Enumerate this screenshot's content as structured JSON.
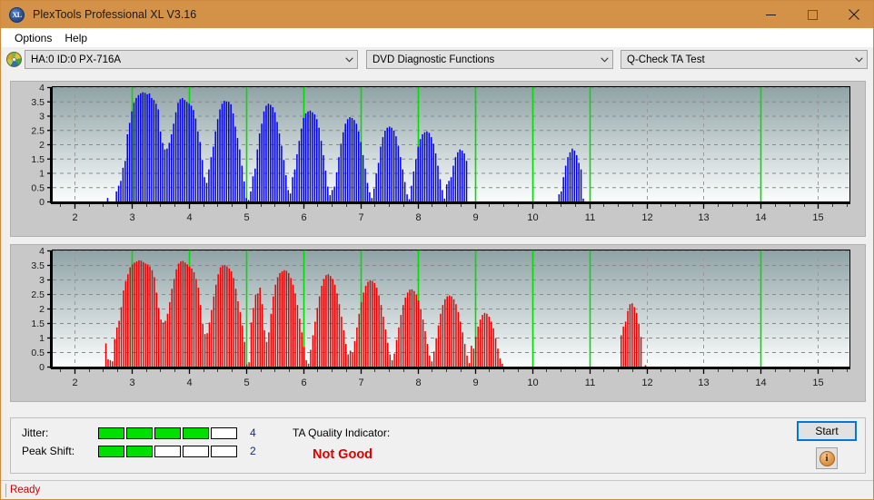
{
  "window": {
    "title": "PlexTools Professional XL V3.16",
    "icon": "xl-app-icon",
    "icon_text": "XL",
    "minimize_label": "Minimize",
    "maximize_label": "Maximize",
    "close_label": "Close"
  },
  "menu": {
    "items": [
      {
        "label": "Options"
      },
      {
        "label": "Help"
      }
    ]
  },
  "toolbar": {
    "drive": {
      "value": "HA:0 ID:0  PX-716A",
      "icon": "optical-disc-icon"
    },
    "function": {
      "value": "DVD Diagnostic Functions"
    },
    "test": {
      "value": "Q-Check TA Test"
    }
  },
  "status_panel": {
    "jitter": {
      "label": "Jitter:",
      "value": 4,
      "max": 5,
      "value_text": "4"
    },
    "peak_shift": {
      "label": "Peak Shift:",
      "value": 2,
      "max": 5,
      "value_text": "2"
    },
    "ta_quality": {
      "label": "TA Quality Indicator:",
      "value": "Not Good",
      "color": "#dd0000"
    },
    "start_button": "Start",
    "info_button": "i"
  },
  "statusbar": {
    "text": "Ready"
  },
  "colors": {
    "titlebar": "#d49248",
    "accent_blue": "#0000ee",
    "accent_red": "#ee0000",
    "marker_green": "#00dd00",
    "meter_green": "#00e000",
    "panel_bg": "#c8c8c8",
    "plot_top": "#8fa3a6",
    "plot_bottom": "#fbfdfd"
  },
  "chart_data": [
    {
      "type": "bar",
      "name": "TA Test - Pit lengths (blue)",
      "series_color": "#0000ee",
      "title": "",
      "xlabel": "",
      "ylabel": "",
      "xlim": [
        1.62,
        15.55
      ],
      "ylim": [
        0,
        4
      ],
      "xticks": [
        2,
        3,
        4,
        5,
        6,
        7,
        8,
        9,
        10,
        11,
        12,
        13,
        14,
        15
      ],
      "yticks": [
        0,
        0.5,
        1,
        1.5,
        2,
        2.5,
        3,
        3.5,
        4
      ],
      "grid": true,
      "markers": {
        "color": "#00dd00",
        "x": [
          3,
          4,
          5,
          6,
          7,
          8,
          9,
          10,
          11,
          14
        ]
      },
      "bar_step": 0.0385,
      "x_start": 2.58,
      "values": [
        0.12,
        0.0,
        0.0,
        0.0,
        0.35,
        0.55,
        0.72,
        1.18,
        1.42,
        2.35,
        2.75,
        3.15,
        3.45,
        3.62,
        3.72,
        3.78,
        3.82,
        3.8,
        3.75,
        3.78,
        3.62,
        3.55,
        3.42,
        3.22,
        2.45,
        2.05,
        1.82,
        1.85,
        2.05,
        2.35,
        2.72,
        3.12,
        3.45,
        3.58,
        3.62,
        3.55,
        3.48,
        3.42,
        3.35,
        3.2,
        2.9,
        2.45,
        2.08,
        1.45,
        0.85,
        0.65,
        1.12,
        1.55,
        1.92,
        2.45,
        2.88,
        3.22,
        3.42,
        3.52,
        3.5,
        3.48,
        3.4,
        3.08,
        2.62,
        2.22,
        1.82,
        1.25,
        0.7,
        0.12,
        0.05,
        0.35,
        0.88,
        1.15,
        1.82,
        2.38,
        2.72,
        3.15,
        3.35,
        3.42,
        3.38,
        3.3,
        3.12,
        2.78,
        2.38,
        1.95,
        1.45,
        0.92,
        0.4,
        0.28,
        0.85,
        1.12,
        1.65,
        2.12,
        2.55,
        2.92,
        3.08,
        3.15,
        3.18,
        3.12,
        3.05,
        2.88,
        2.58,
        2.12,
        1.62,
        1.08,
        0.52,
        0.22,
        0.4,
        0.52,
        1.02,
        1.55,
        2.02,
        2.42,
        2.72,
        2.88,
        2.95,
        2.92,
        2.85,
        2.72,
        2.45,
        2.08,
        1.62,
        1.15,
        0.65,
        0.32,
        0.12,
        0.45,
        0.98,
        1.35,
        1.92,
        2.25,
        2.48,
        2.58,
        2.62,
        2.58,
        2.48,
        2.28,
        1.95,
        1.55,
        1.12,
        0.68,
        0.25,
        0.08,
        0.55,
        1.05,
        1.48,
        1.92,
        2.18,
        2.35,
        2.42,
        2.45,
        2.4,
        2.25,
        2.02,
        1.68,
        1.25,
        0.78,
        0.4,
        0.1,
        0.6,
        0.72,
        0.85,
        1.25,
        1.55,
        1.72,
        1.82,
        1.78,
        1.68,
        1.42,
        0.0,
        0.0,
        0.0,
        0.0,
        0.0,
        0.0,
        0.0,
        0.0,
        0.0,
        0.0,
        0.0,
        0.0,
        0.0,
        0.0,
        0.0,
        0.0,
        0.0,
        0.0,
        0.0,
        0.0,
        0.0,
        0.0,
        0.0,
        0.0,
        0.0,
        0.0,
        0.0,
        0.0,
        0.0,
        0.0,
        0.0,
        0.0,
        0.0,
        0.0,
        0.0,
        0.0,
        0.0,
        0.0,
        0.0,
        0.0,
        0.0,
        0.25,
        0.35,
        0.85,
        1.25,
        1.55,
        1.72,
        1.85,
        1.78,
        1.62,
        1.35,
        1.12,
        0.1
      ]
    },
    {
      "type": "bar",
      "name": "TA Test - Land lengths (red)",
      "series_color": "#ee0000",
      "title": "",
      "xlabel": "",
      "ylabel": "",
      "xlim": [
        1.62,
        15.55
      ],
      "ylim": [
        0,
        4
      ],
      "xticks": [
        2,
        3,
        4,
        5,
        6,
        7,
        8,
        9,
        10,
        11,
        12,
        13,
        14,
        15
      ],
      "yticks": [
        0,
        0.5,
        1,
        1.5,
        2,
        2.5,
        3,
        3.5,
        4
      ],
      "grid": true,
      "markers": {
        "color": "#00dd00",
        "x": [
          3,
          4,
          5,
          6,
          7,
          8,
          9,
          10,
          11,
          14
        ]
      },
      "bar_step": 0.0385,
      "x_start": 2.55,
      "values": [
        0.8,
        0.25,
        0.22,
        0.18,
        0.95,
        1.35,
        1.58,
        2.05,
        2.62,
        2.95,
        3.18,
        3.42,
        3.52,
        3.58,
        3.62,
        3.66,
        3.65,
        3.6,
        3.55,
        3.52,
        3.45,
        3.32,
        3.08,
        2.55,
        2.02,
        1.62,
        1.52,
        1.58,
        1.82,
        2.22,
        2.68,
        3.02,
        3.35,
        3.55,
        3.62,
        3.64,
        3.58,
        3.52,
        3.45,
        3.38,
        3.25,
        3.02,
        2.72,
        2.12,
        1.48,
        1.12,
        1.15,
        1.52,
        1.95,
        2.42,
        2.82,
        3.18,
        3.42,
        3.48,
        3.5,
        3.45,
        3.38,
        3.28,
        3.05,
        2.68,
        2.25,
        1.88,
        1.42,
        0.85,
        0.08,
        0.15,
        1.52,
        2.02,
        2.48,
        2.52,
        2.72,
        2.15,
        1.25,
        0.85,
        1.18,
        1.82,
        2.42,
        2.82,
        3.08,
        3.22,
        3.28,
        3.32,
        3.3,
        3.22,
        3.05,
        2.82,
        2.52,
        2.12,
        1.65,
        1.18,
        0.68,
        0.22,
        0.1,
        0.58,
        1.08,
        1.55,
        2.02,
        2.42,
        2.78,
        3.02,
        3.15,
        3.18,
        3.12,
        3.02,
        2.82,
        2.52,
        2.15,
        1.72,
        1.25,
        0.78,
        0.42,
        0.55,
        0.48,
        0.88,
        1.35,
        1.82,
        2.22,
        2.55,
        2.78,
        2.92,
        2.98,
        2.95,
        2.88,
        2.72,
        2.45,
        2.12,
        1.72,
        1.28,
        0.82,
        0.42,
        0.22,
        0.45,
        0.92,
        1.35,
        1.78,
        2.12,
        2.38,
        2.55,
        2.65,
        2.66,
        2.6,
        2.48,
        2.28,
        1.98,
        1.62,
        1.22,
        0.78,
        0.38,
        0.18,
        0.52,
        0.98,
        1.42,
        1.82,
        2.12,
        2.32,
        2.42,
        2.45,
        2.42,
        2.32,
        2.15,
        1.88,
        1.55,
        1.18,
        0.78,
        0.38,
        0.12,
        0.72,
        0.62,
        1.02,
        1.38,
        1.62,
        1.78,
        1.85,
        1.82,
        1.72,
        1.55,
        1.32,
        0.98,
        0.62,
        0.28,
        0.1,
        0.0,
        0.0,
        0.0,
        0.0,
        0.0,
        0.0,
        0.0,
        0.0,
        0.0,
        0.0,
        0.0,
        0.0,
        0.0,
        0.0,
        0.0,
        0.0,
        0.0,
        0.0,
        0.0,
        0.0,
        0.0,
        0.0,
        0.0,
        0.0,
        0.0,
        0.0,
        0.0,
        0.0,
        0.0,
        0.0,
        0.0,
        0.0,
        0.0,
        0.0,
        0.0,
        0.0,
        0.0,
        0.0,
        0.0,
        0.0,
        0.0,
        0.0,
        0.0,
        0.0,
        0.0,
        0.0,
        0.0,
        0.0,
        0.0,
        0.0,
        0.0,
        0.0,
        0.0,
        1.08,
        1.38,
        1.55,
        1.92,
        2.15,
        2.18,
        2.05,
        1.85,
        1.48,
        1.02,
        0.0,
        0.05
      ]
    }
  ]
}
